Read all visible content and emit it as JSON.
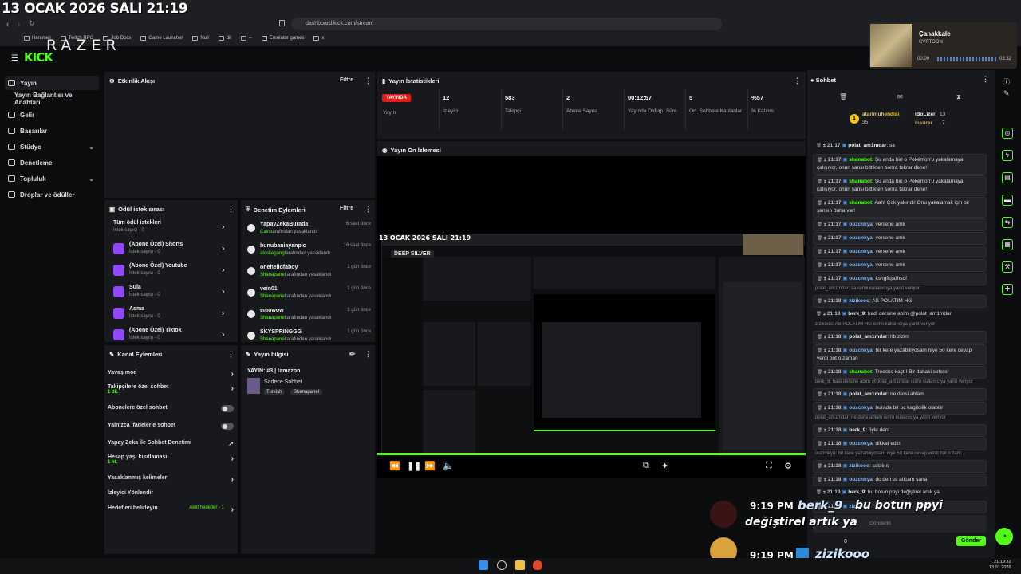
{
  "overlay_date": "13 OCAK 2026 SALI 21:19",
  "browser": {
    "url": "dashboard.kick.com/stream",
    "bookmarks": [
      "Hanımeli",
      "Twitch RPG",
      "Job Docs",
      "Game Launcher",
      "Null",
      "dil",
      "--",
      "Emulator games",
      "x"
    ]
  },
  "brand": {
    "razer": "RAZER",
    "kick": "KICK"
  },
  "media": {
    "title": "Çanakkale",
    "artist": "CVRTOON",
    "elapsed": "00:00",
    "duration": "03:32"
  },
  "sidebar": {
    "items": [
      {
        "label": "Yayın",
        "active": true
      },
      {
        "label": "Yayın Bağlantısı ve Anahtarı"
      },
      {
        "label": "Gelir"
      },
      {
        "label": "Başarılar"
      },
      {
        "label": "Stüdyo",
        "expandable": true
      },
      {
        "label": "Denetleme"
      },
      {
        "label": "Topluluk",
        "expandable": true
      },
      {
        "label": "Droplar ve ödüller"
      }
    ]
  },
  "activity": {
    "title": "Etkinlik Akışı",
    "filter": "Filtre"
  },
  "stats": {
    "title": "Yayın İstatistikleri",
    "live_badge": "YAYINDA",
    "live_label": "Yayın",
    "items": [
      {
        "value": "12",
        "label": "İzleyici"
      },
      {
        "value": "583",
        "label": "Takipçi"
      },
      {
        "value": "2",
        "label": "Abone Sayısı"
      },
      {
        "value": "00:12:57",
        "label": "Yayında Olduğu Süre"
      },
      {
        "value": "5",
        "label": "Ort. Sohbete Katılanlar"
      },
      {
        "value": "%57",
        "label": "% Katılım"
      }
    ]
  },
  "preview": {
    "title": "Yayın Ön İzlemesi",
    "nested_date": "13 OCAK 2026 SALI 21:19",
    "nested_brand": "DEEP SILVER"
  },
  "rewards": {
    "title": "Ödül istek sırası",
    "items": [
      {
        "name": "Tüm ödül istekleri",
        "sub": "İstek sayısı - 0"
      },
      {
        "name": "(Abone Özel) Shorts",
        "sub": "İstek sayısı - 0"
      },
      {
        "name": "(Abone Özel) Youtube",
        "sub": "İstek sayısı - 0"
      },
      {
        "name": "Sula",
        "sub": "İstek sayısı - 0"
      },
      {
        "name": "Asma",
        "sub": "İstek sayısı - 0"
      },
      {
        "name": "(Abone Özel) Tiktok",
        "sub": "İstek sayısı - 0"
      }
    ]
  },
  "moderation": {
    "title": "Denetim Eylemleri",
    "filter": "Filtre",
    "items": [
      {
        "name": "YapayZekaBurada",
        "by": "Cavs",
        "suffix": "tarafından yasaklandı",
        "time": "6 saat önce"
      },
      {
        "name": "bunubaniayanpic",
        "by": "aloskegang",
        "suffix": "tarafından yasaklandı",
        "time": "16 saat önce"
      },
      {
        "name": "onehellofaboy",
        "by": "Shanapanel",
        "suffix": "tarafından yasaklandı",
        "time": "1 gün önce"
      },
      {
        "name": "vein01",
        "by": "Shanapanel",
        "suffix": "tarafından yasaklandı",
        "time": "1 gün önce"
      },
      {
        "name": "emowow",
        "by": "Shanapanel",
        "suffix": "tarafından yasaklandı",
        "time": "1 gün önce"
      },
      {
        "name": "SKYSPRINGGG",
        "by": "Shanapanel",
        "suffix": "tarafından yasaklandı",
        "time": "1 gün önce"
      }
    ]
  },
  "channel_actions": {
    "title": "Kanal Eylemleri",
    "rows": [
      {
        "label": "Yavaş mod",
        "kind": "arrow"
      },
      {
        "label": "Takipçilere özel sohbet",
        "sub": "1 dk.",
        "kind": "arrow"
      },
      {
        "label": "Abonelere özel sohbet",
        "kind": "toggle"
      },
      {
        "label": "Yalnızca ifadelerle sohbet",
        "kind": "toggle"
      },
      {
        "label": "Yapay Zeka ile Sohbet Denetimi",
        "kind": "link"
      },
      {
        "label": "Hesap yaşı kısıtlaması",
        "sub": "1 hf.",
        "kind": "arrow"
      },
      {
        "label": "Yasaklanmış kelimeler",
        "kind": "arrow"
      },
      {
        "label": "İzleyici Yönlendir",
        "kind": "none"
      },
      {
        "label": "Hedefleri belirleyin",
        "extra": "Aktif hedefler - 1",
        "kind": "arrow"
      }
    ]
  },
  "stream_info": {
    "title": "Yayın bilgisi",
    "stream_title": "YAYIN: #3 | !amazon",
    "category": "Sadece Sohbet",
    "tags": [
      "Turkish",
      "Shanapanel"
    ]
  },
  "chat": {
    "title": "Sohbet",
    "leaders": [
      {
        "name": "atarimuhendisi",
        "score": "35"
      },
      {
        "name": "iBoLizer",
        "score": "13"
      },
      {
        "name": "Insurer",
        "score": "7"
      }
    ],
    "messages": [
      {
        "time": "21:17",
        "user": "polat_am1mdar",
        "text": "sa",
        "style": "plain"
      },
      {
        "time": "21:17",
        "user": "shanabot",
        "text": "Şu anda biri o Pokémon'u yakalamaya çalışıyor, onun şansı bittikten sonra tekrar dene!",
        "style": "box"
      },
      {
        "time": "21:17",
        "user": "shanabot",
        "text": "Şu anda biri o Pokémon'u yakalamaya çalışıyor, onun şansı bittikten sonra tekrar dene!",
        "style": "box"
      },
      {
        "time": "21:17",
        "user": "shanabot",
        "text": "Aah! Çok yakındı! Onu yakalamak için bir şansın daha var!",
        "style": "box"
      },
      {
        "time": "21:17",
        "user": "ouzcnkya",
        "text": "versene amk",
        "style": "box"
      },
      {
        "time": "21:17",
        "user": "ouzcnkya",
        "text": "versene amk",
        "style": "box"
      },
      {
        "time": "21:17",
        "user": "ouzcnkya",
        "text": "versene amk",
        "style": "box"
      },
      {
        "time": "21:17",
        "user": "ouzcnkya",
        "text": "versene amk",
        "style": "box"
      },
      {
        "time": "21:17",
        "user": "ouzcnkya",
        "text": "kshgfkjsdhsdf",
        "style": "box"
      },
      {
        "reply": "polat_am1mdar: sa isimli kullanıcıya yanıt veriyor"
      },
      {
        "time": "21:18",
        "user": "zizikooo",
        "text": "AS POLATIM HG",
        "style": "box"
      },
      {
        "time": "21:18",
        "user": "berk_9",
        "text": "hadi dersine abim @polat_am1mdar",
        "style": "plain"
      },
      {
        "reply": "zizikooo: AS POLATIM HG isimli kullanıcıya yanıt veriyor"
      },
      {
        "time": "21:18",
        "user": "polat_am1mdar",
        "text": "hb zizim",
        "style": "box"
      },
      {
        "time": "21:18",
        "user": "ouzcnkya",
        "text": "bir kere yazabiliyosam niye 50 kere cevap verdi bot o zaman",
        "style": "box"
      },
      {
        "time": "21:18",
        "user": "shanabot",
        "text": "Treecko kaçtı! Bir dahaki sefere!",
        "style": "box"
      },
      {
        "reply": "berk_9: hadi dersine abim @polat_am1mdar isimli kullanıcıya yanıt veriyor"
      },
      {
        "time": "21:18",
        "user": "polat_am1mdar",
        "text": "ne dersi ablam",
        "style": "box"
      },
      {
        "time": "21:18",
        "user": "ouzcnkya",
        "text": "burada bir uc kagitcilik olabilir",
        "style": "box"
      },
      {
        "reply": "polat_am1mdar: ne dersi ablam isimli kullanıcıya yanıt veriyor"
      },
      {
        "time": "21:18",
        "user": "berk_9",
        "text": "öyle ders",
        "style": "box"
      },
      {
        "time": "21:18",
        "user": "ouzcnkya",
        "text": "dikkat edin",
        "style": "box"
      },
      {
        "reply": "ouzcnkya: bir kere yazabiliyosam niye 50 kere cevap verdi bot o zam..."
      },
      {
        "time": "21:18",
        "user": "zizikooo",
        "text": "salak o",
        "style": "box"
      },
      {
        "time": "21:18",
        "user": "ouzcnkya",
        "text": "dc den ss aticam sana",
        "style": "box"
      },
      {
        "time": "21:19",
        "user": "berk_9",
        "text": "bu botun ppyi değiştirel artık ya",
        "style": "plain"
      },
      {
        "time": "21:19",
        "user": "zizikooo",
        "text": "",
        "style": "box"
      }
    ],
    "input_placeholder": "Gönderin",
    "send_label": "Gönder",
    "viewer_count": "0"
  },
  "overlay_chat": [
    {
      "time": "9:19 PM",
      "user": "berk_9",
      "text": "bu botun ppyi",
      "text2": "değiştirel artık ya"
    },
    {
      "time": "9:19 PM",
      "user": "zizikooo",
      "text": ""
    }
  ],
  "taskbar": {
    "time": "21:19:32",
    "date": "13.01.2026"
  },
  "colors": {
    "accent": "#53fc18",
    "live": "#e91916",
    "reward": "#9146ff"
  }
}
